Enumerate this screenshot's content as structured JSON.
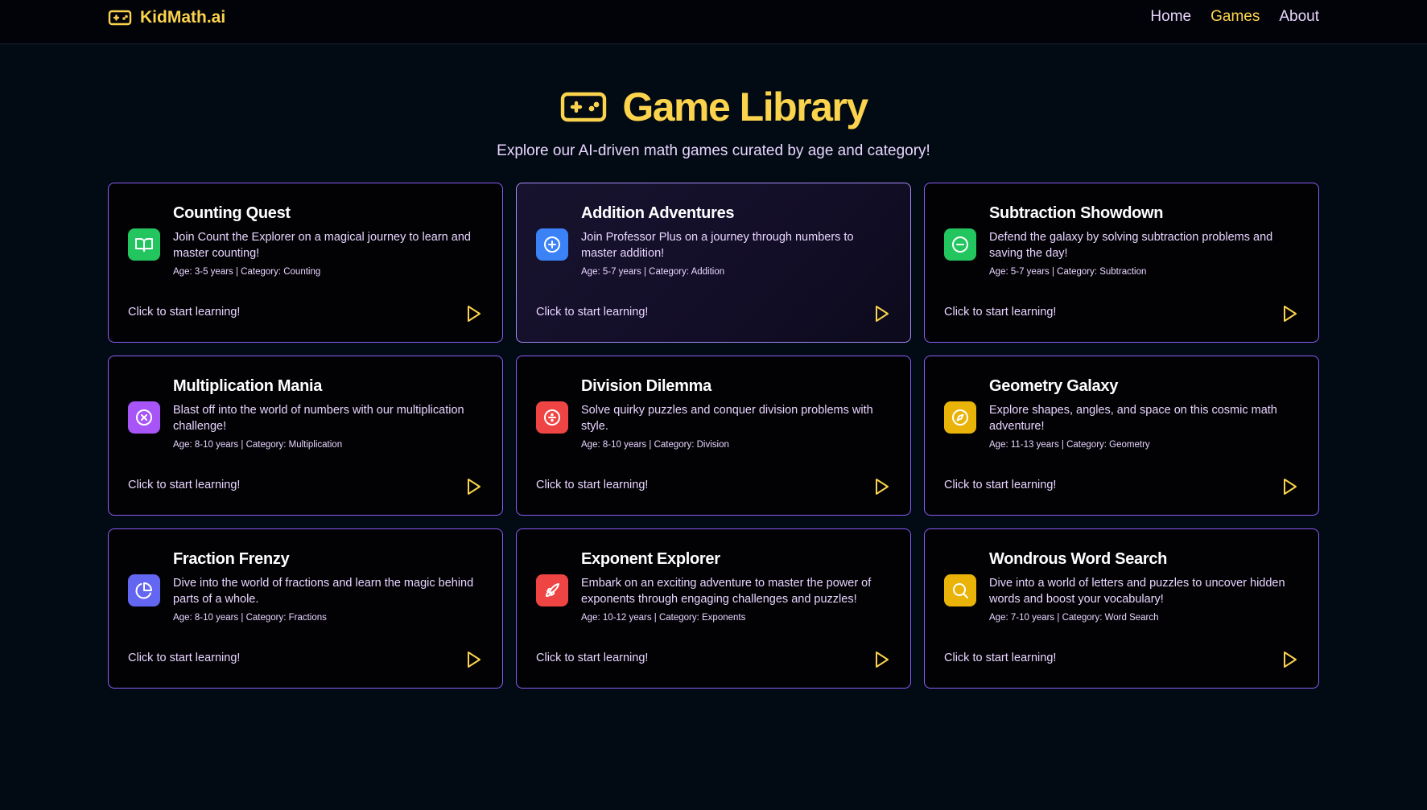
{
  "brand": {
    "name": "KidMath.ai",
    "icon": "gamepad-icon"
  },
  "nav": [
    {
      "label": "Home",
      "active": false
    },
    {
      "label": "Games",
      "active": true
    },
    {
      "label": "About",
      "active": false
    }
  ],
  "hero": {
    "title": "Game Library",
    "icon": "gamepad-icon",
    "subtitle": "Explore our AI-driven math games curated by age and category!"
  },
  "colors": {
    "accent": "#fcd34d",
    "text_soft": "#e9d5ff",
    "border": "#8b5cf6",
    "background": "#020b14"
  },
  "games": [
    {
      "title": "Counting Quest",
      "description": "Join Count the Explorer on a magical journey to learn and master counting!",
      "meta": "Age: 3-5 years | Category: Counting",
      "cta": "Click to start learning!",
      "icon": "book-icon",
      "icon_color": "#22c55e"
    },
    {
      "title": "Addition Adventures",
      "description": "Join Professor Plus on a journey through numbers to master addition!",
      "meta": "Age: 5-7 years | Category: Addition",
      "cta": "Click to start learning!",
      "icon": "plus-circle-icon",
      "icon_color": "#3b82f6"
    },
    {
      "title": "Subtraction Showdown",
      "description": "Defend the galaxy by solving subtraction problems and saving the day!",
      "meta": "Age: 5-7 years | Category: Subtraction",
      "cta": "Click to start learning!",
      "icon": "minus-circle-icon",
      "icon_color": "#22c55e"
    },
    {
      "title": "Multiplication Mania",
      "description": "Blast off into the world of numbers with our multiplication challenge!",
      "meta": "Age: 8-10 years | Category: Multiplication",
      "cta": "Click to start learning!",
      "icon": "x-circle-icon",
      "icon_color": "#a855f7"
    },
    {
      "title": "Division Dilemma",
      "description": "Solve quirky puzzles and conquer division problems with style.",
      "meta": "Age: 8-10 years | Category: Division",
      "cta": "Click to start learning!",
      "icon": "divide-circle-icon",
      "icon_color": "#ef4444"
    },
    {
      "title": "Geometry Galaxy",
      "description": "Explore shapes, angles, and space on this cosmic math adventure!",
      "meta": "Age: 11-13 years | Category: Geometry",
      "cta": "Click to start learning!",
      "icon": "compass-icon",
      "icon_color": "#eab308"
    },
    {
      "title": "Fraction Frenzy",
      "description": "Dive into the world of fractions and learn the magic behind parts of a whole.",
      "meta": "Age: 8-10 years | Category: Fractions",
      "cta": "Click to start learning!",
      "icon": "pie-chart-icon",
      "icon_color": "#6366f1"
    },
    {
      "title": "Exponent Explorer",
      "description": "Embark on an exciting adventure to master the power of exponents through engaging challenges and puzzles!",
      "meta": "Age: 10-12 years | Category: Exponents",
      "cta": "Click to start learning!",
      "icon": "rocket-icon",
      "icon_color": "#ef4444"
    },
    {
      "title": "Wondrous Word Search",
      "description": "Dive into a world of letters and puzzles to uncover hidden words and boost your vocabulary!",
      "meta": "Age: 7-10 years | Category: Word Search",
      "cta": "Click to start learning!",
      "icon": "search-icon",
      "icon_color": "#eab308"
    }
  ]
}
